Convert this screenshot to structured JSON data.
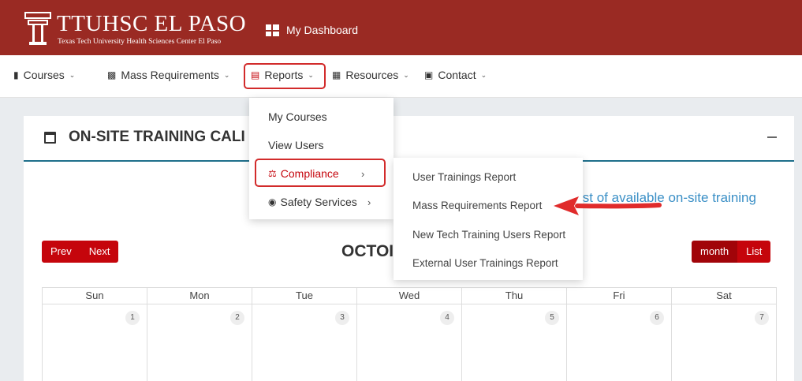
{
  "header": {
    "brand_title": "TTUHSC EL PASO",
    "brand_subtitle": "Texas Tech University Health Sciences Center El Paso",
    "dashboard_label": "My Dashboard",
    "color": "#9a2a23"
  },
  "nav": {
    "courses": "Courses",
    "mass_requirements": "Mass Requirements",
    "reports": "Reports",
    "resources": "Resources",
    "contact": "Contact"
  },
  "dropdown": {
    "my_courses": "My Courses",
    "view_users": "View Users",
    "compliance": "Compliance",
    "safety_services": "Safety Services"
  },
  "submenu": {
    "user_trainings_report": "User Trainings Report",
    "mass_requirements_report": "Mass Requirements Report",
    "new_tech_training_users_report": "New Tech Training Users Report",
    "external_user_trainings_report": "External User Trainings Report"
  },
  "card": {
    "title": "ON-SITE TRAINING CALI",
    "link_text": "ist of available on-site training"
  },
  "calendar": {
    "prev": "Prev",
    "next": "Next",
    "month_title": "OCTOI",
    "view_month": "month",
    "view_list": "List",
    "days": [
      "Sun",
      "Mon",
      "Tue",
      "Wed",
      "Thu",
      "Fri",
      "Sat"
    ],
    "dates": [
      "1",
      "2",
      "3",
      "4",
      "5",
      "6",
      "7"
    ]
  },
  "colors": {
    "accent_red": "#c5050c",
    "highlight_box": "#d22b2b",
    "link_blue": "#3a8fc6",
    "header_rule": "#1f6f8b"
  }
}
